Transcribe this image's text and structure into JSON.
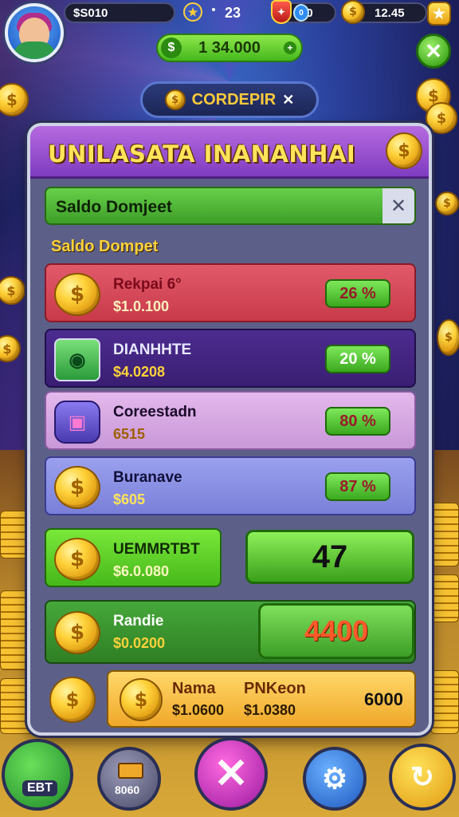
{
  "topbar": {
    "balance": "$S010",
    "level": "23",
    "shield_value": "60",
    "coins": "12.45"
  },
  "header": {
    "green_value": "1 34.000",
    "banner_label": "CORDEPIR"
  },
  "panel": {
    "title": "UNILASATA INANANHAI",
    "search_label": "Saldo Domjeet",
    "section_label": "Saldo Dompet",
    "rows": [
      {
        "name": "Rekpai 6°",
        "amount": "$1.0.100",
        "pct": "26 %"
      },
      {
        "name": "DIANHHTE",
        "amount": "$4.0208",
        "pct": "20 %"
      },
      {
        "name": "Coreestadn",
        "amount": "6515",
        "pct": "80 %"
      },
      {
        "name": "Buranave",
        "amount": "$605",
        "pct": "87 %"
      }
    ],
    "green_card": {
      "name": "UEMMRTBT",
      "amount": "$6.0.080",
      "value": "47"
    },
    "random_card": {
      "name": "Randie",
      "amount": "$0.0200",
      "value": "4400"
    },
    "gold_card": {
      "name1": "Nama",
      "name2": "PNKeon",
      "amount1": "$1.0600",
      "amount2": "$1.0380",
      "value": "6000"
    }
  },
  "nav": {
    "left_label": "EBT",
    "second_label": "8060"
  },
  "colors": {
    "panel_head": "#8a44cc",
    "row_red": "#d94a5a",
    "row_purple": "#4a2a8a",
    "row_pink": "#d8a8e0",
    "row_blue": "#8a8ee0",
    "accent_gold": "#ffd23a"
  }
}
